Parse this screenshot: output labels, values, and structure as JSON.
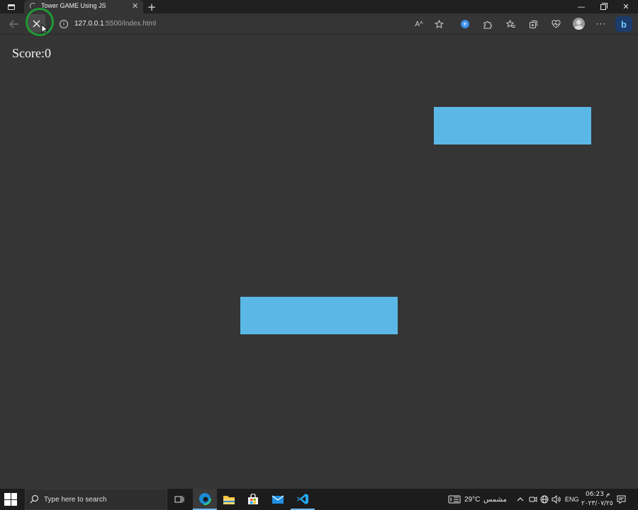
{
  "browser": {
    "tab": {
      "title": "Tower GAME Using JS",
      "close_glyph": "✕"
    },
    "new_tab_glyph": "+",
    "window": {
      "minimize_glyph": "—",
      "close_glyph": "✕"
    },
    "address": {
      "host": "127.0.0.1",
      "path": ":5500/index.html"
    },
    "read_aloud_glyph": "Aᴬ",
    "more_glyph": "···",
    "bing_glyph": "b",
    "ext_glyph": "e"
  },
  "game": {
    "score_label": "Score:0",
    "block_color": "#5bb8e6",
    "background_color": "#353535"
  },
  "taskbar": {
    "search_placeholder": "Type here to search",
    "weather": {
      "temp": "29°C",
      "desc": "مشمس"
    },
    "language": "ENG",
    "clock": {
      "time": "06:23 م",
      "date": "٢٠٢٣/٠٧/٢٥"
    }
  },
  "icons": {
    "back": "back-arrow-icon",
    "stop": "close-icon",
    "site_info": "info-icon",
    "favorite": "star-icon",
    "extensions": "puzzle-icon",
    "collections": "collections-icon",
    "performance": "heart-pulse-icon",
    "bing": "bing-icon"
  }
}
